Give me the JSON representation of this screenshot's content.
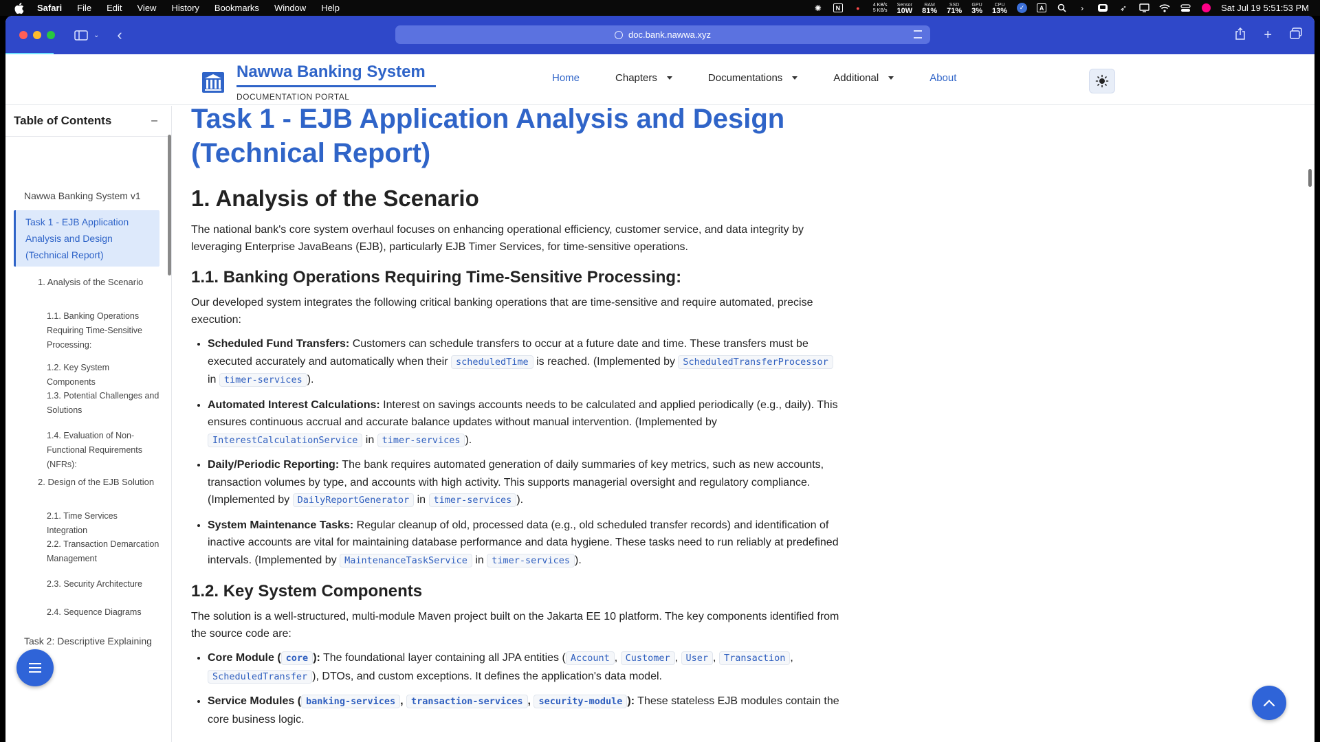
{
  "menubar": {
    "app": "Safari",
    "items": [
      "File",
      "Edit",
      "View",
      "History",
      "Bookmarks",
      "Window",
      "Help"
    ],
    "net_up": "4 KB/s",
    "net_down": "5 KB/s",
    "sensor_label": "Sensor",
    "sensor_value": "10W",
    "ram_label": "RAM",
    "ram_value": "81%",
    "ssd_label": "SSD",
    "ssd_value": "71%",
    "gpu_label": "GPU",
    "gpu_value": "3%",
    "cpu_label": "CPU",
    "cpu_value": "13%",
    "datetime": "Sat Jul 19  5:51:53 PM"
  },
  "browser": {
    "url": "doc.bank.nawwa.xyz"
  },
  "site": {
    "brand": "Nawwa Banking System",
    "subtitle": "DOCUMENTATION PORTAL",
    "nav": {
      "home": "Home",
      "chapters": "Chapters",
      "documentations": "Documentations",
      "additional": "Additional",
      "about": "About"
    }
  },
  "toc": {
    "title": "Table of Contents",
    "toggle": "–",
    "items": [
      "Nawwa Banking System v1",
      "Task 1 - EJB Application Analysis and Design (Technical Report)",
      "1. Analysis of the Scenario",
      "1.1. Banking Operations Requiring Time-Sensitive Processing:",
      "1.2. Key System Components",
      "1.3. Potential Challenges and Solutions",
      "1.4. Evaluation of Non-Functional Requirements (NFRs):",
      "2. Design of the EJB Solution",
      "2.1. Time Services Integration",
      "2.2. Transaction Demarcation Management",
      "2.3. Security Architecture",
      "2.4. Sequence Diagrams",
      "Task 2: Descriptive Explaining of"
    ]
  },
  "content": {
    "title": "Task 1 - EJB Application Analysis and Design (Technical Report)",
    "h2_analysis": "1. Analysis of the Scenario",
    "intro": "The national bank's core system overhaul focuses on enhancing operational efficiency, customer service, and data integrity by leveraging Enterprise JavaBeans (EJB), particularly EJB Timer Services, for time-sensitive operations.",
    "h3_ops": "1.1. Banking Operations Requiring Time-Sensitive Processing:",
    "ops_intro": "Our developed system integrates the following critical banking operations that are time-sensitive and require automated, precise execution:",
    "ops": {
      "fund": {
        "title": "Scheduled Fund Transfers:",
        "t1": " Customers can schedule transfers to occur at a future date and time. These transfers must be executed accurately and automatically when their ",
        "c1": "scheduledTime",
        "t2": " is reached. (Implemented by ",
        "c2": "ScheduledTransferProcessor",
        "t3": " in ",
        "c3": "timer-services",
        "t4": ")."
      },
      "interest": {
        "title": "Automated Interest Calculations:",
        "t1": " Interest on savings accounts needs to be calculated and applied periodically (e.g., daily). This ensures continuous accrual and accurate balance updates without manual intervention. (Implemented by ",
        "c1": "InterestCalculationService",
        "t2": " in ",
        "c2": "timer-services",
        "t3": ")."
      },
      "report": {
        "title": "Daily/Periodic Reporting:",
        "t1": " The bank requires automated generation of daily summaries of key metrics, such as new accounts, transaction volumes by type, and accounts with high activity. This supports managerial oversight and regulatory compliance. (Implemented by ",
        "c1": "DailyReportGenerator",
        "t2": " in ",
        "c2": "timer-services",
        "t3": ")."
      },
      "maint": {
        "title": "System Maintenance Tasks:",
        "t1": " Regular cleanup of old, processed data (e.g., old scheduled transfer records) and identification of inactive accounts are vital for maintaining database performance and data hygiene. These tasks need to run reliably at predefined intervals. (Implemented by ",
        "c1": "MaintenanceTaskService",
        "t2": " in ",
        "c2": "timer-services",
        "t3": ")."
      }
    },
    "h3_components": "1.2. Key System Components",
    "comp_intro": "The solution is a well-structured, multi-module Maven project built on the Jakarta EE 10 platform. The key components identified from the source code are:",
    "core": {
      "title_a": "Core Module (",
      "code": "core",
      "title_b": "):",
      "t1": " The foundational layer containing all JPA entities (",
      "e1": "Account",
      "e2": "Customer",
      "e3": "User",
      "e4": "Transaction",
      "e5": "ScheduledTransfer",
      "sep": ", ",
      "t2": "), DTOs, and custom exceptions. It defines the application's data model."
    },
    "service": {
      "title_a": "Service Modules (",
      "c1": "banking-services",
      "c2": "transaction-services",
      "c3": "security-module",
      "sep": ", ",
      "title_b": "):",
      "t1": " These stateless EJB modules contain the core business logic."
    }
  },
  "colors": {
    "accent": "#2f64c8",
    "toolbar": "#2f48c9",
    "toc_active_bg": "#dde9fb"
  },
  "icons": [
    "apple-icon",
    "sidebar-icon",
    "back-icon",
    "globe-icon",
    "reader-icon",
    "share-icon",
    "new-tab-icon",
    "tabs-overview-icon",
    "bank-logo-icon",
    "sun-icon",
    "menu-icon",
    "arrow-up-icon"
  ]
}
